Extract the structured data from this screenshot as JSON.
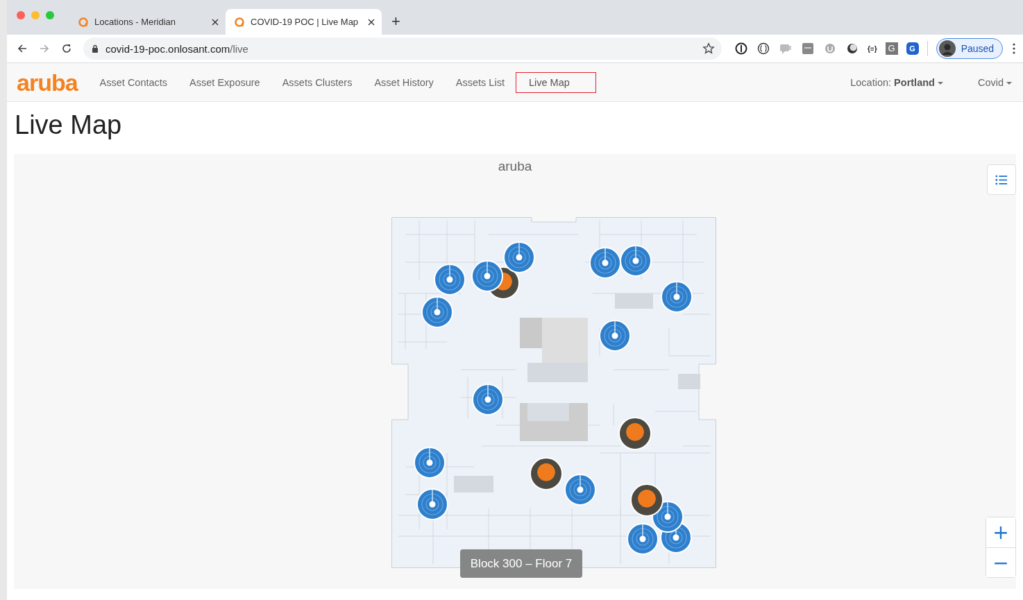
{
  "browser": {
    "tabs": [
      {
        "title": "Locations - Meridian",
        "selected": false
      },
      {
        "title": "COVID-19 POC | Live Map",
        "selected": true
      }
    ],
    "new_tab": "+",
    "url": {
      "host": "covid-19-poc.onlosant.com",
      "path": "/live"
    },
    "extensions": [
      {
        "kind": "ring"
      },
      {
        "kind": "braces"
      },
      {
        "kind": "chat"
      },
      {
        "kind": "square"
      },
      {
        "kind": "circle"
      },
      {
        "kind": "ball"
      },
      {
        "kind": "text",
        "glyph": "{≡}"
      },
      {
        "kind": "letter",
        "glyph": "G"
      },
      {
        "kind": "hex",
        "glyph": "G"
      }
    ],
    "profile_label": "Paused"
  },
  "nav": {
    "logo": "aruba",
    "items": [
      {
        "label": "Asset Contacts",
        "selected": false
      },
      {
        "label": "Asset Exposure",
        "selected": false
      },
      {
        "label": "Assets Clusters",
        "selected": false
      },
      {
        "label": "Asset History",
        "selected": false
      },
      {
        "label": "Assets List",
        "selected": false
      },
      {
        "label": "Live Map",
        "selected": true
      }
    ],
    "location_label": "Location:",
    "location_value": "Portland",
    "user": "Covid"
  },
  "page_title": "Live Map",
  "map": {
    "logo": "aruba",
    "floor_label": "Block 300 – Floor 7",
    "zoom_in": "+",
    "zoom_out": "−",
    "markers": [
      {
        "kind": "photo"
      },
      {
        "kind": "beacon"
      },
      {
        "kind": "beacon"
      },
      {
        "kind": "beacon"
      },
      {
        "kind": "beacon"
      },
      {
        "kind": "beacon"
      },
      {
        "kind": "beacon"
      },
      {
        "kind": "beacon"
      },
      {
        "kind": "beacon"
      },
      {
        "kind": "beacon"
      },
      {
        "kind": "photo"
      },
      {
        "kind": "photo"
      },
      {
        "kind": "beacon"
      },
      {
        "kind": "beacon"
      },
      {
        "kind": "beacon"
      },
      {
        "kind": "beacon"
      },
      {
        "kind": "beacon"
      },
      {
        "kind": "beacon"
      },
      {
        "kind": "photo"
      }
    ]
  }
}
